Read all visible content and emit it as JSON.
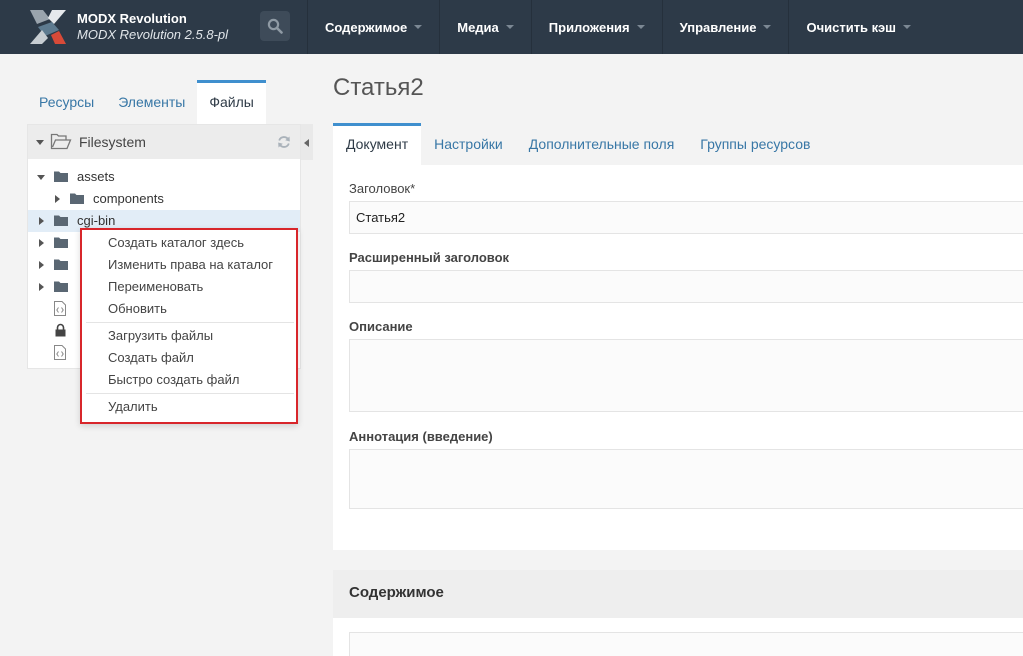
{
  "header": {
    "brand_name": "MODX Revolution",
    "brand_version": "MODX Revolution 2.5.8-pl",
    "menu": [
      {
        "label": "Содержимое"
      },
      {
        "label": "Медиа"
      },
      {
        "label": "Приложения"
      },
      {
        "label": "Управление"
      },
      {
        "label": "Очистить кэш"
      }
    ]
  },
  "left_panel": {
    "tabs": [
      {
        "label": "Ресурсы",
        "active": false
      },
      {
        "label": "Элементы",
        "active": false
      },
      {
        "label": "Файлы",
        "active": true
      }
    ],
    "tree": {
      "root_label": "Filesystem",
      "items": [
        {
          "label": "assets",
          "type": "folder",
          "expanded": true
        },
        {
          "label": "components",
          "type": "folder",
          "expanded": false
        },
        {
          "label": "cgi-bin",
          "type": "folder",
          "expanded": false,
          "selected": true
        },
        {
          "label": "",
          "type": "folder"
        },
        {
          "label": "",
          "type": "folder"
        },
        {
          "label": "",
          "type": "folder"
        },
        {
          "label": "",
          "type": "file-code"
        },
        {
          "label": "",
          "type": "file-locked"
        },
        {
          "label": "",
          "type": "file-code"
        }
      ]
    }
  },
  "context_menu": {
    "group1": [
      "Создать каталог здесь",
      "Изменить права на каталог",
      "Переименовать",
      "Обновить"
    ],
    "group2": [
      "Загрузить файлы",
      "Создать файл",
      "Быстро создать файл"
    ],
    "group3": [
      "Удалить"
    ],
    "highlight_color": "#d8262b"
  },
  "main": {
    "title": "Статья2",
    "tabs": [
      {
        "label": "Документ",
        "active": true
      },
      {
        "label": "Настройки",
        "active": false
      },
      {
        "label": "Дополнительные поля",
        "active": false
      },
      {
        "label": "Группы ресурсов",
        "active": false
      }
    ],
    "fields": {
      "pagetitle": {
        "label": "Заголовок",
        "required_mark": "*",
        "value": "Статья2"
      },
      "longtitle": {
        "label": "Расширенный заголовок",
        "value": ""
      },
      "description": {
        "label": "Описание",
        "value": ""
      },
      "introtext": {
        "label": "Аннотация (введение)",
        "value": ""
      }
    },
    "content_section": {
      "title": "Содержимое"
    }
  },
  "colors": {
    "topbar": "#2d3a48",
    "accent": "#3f8fce",
    "link": "#3877a6"
  }
}
